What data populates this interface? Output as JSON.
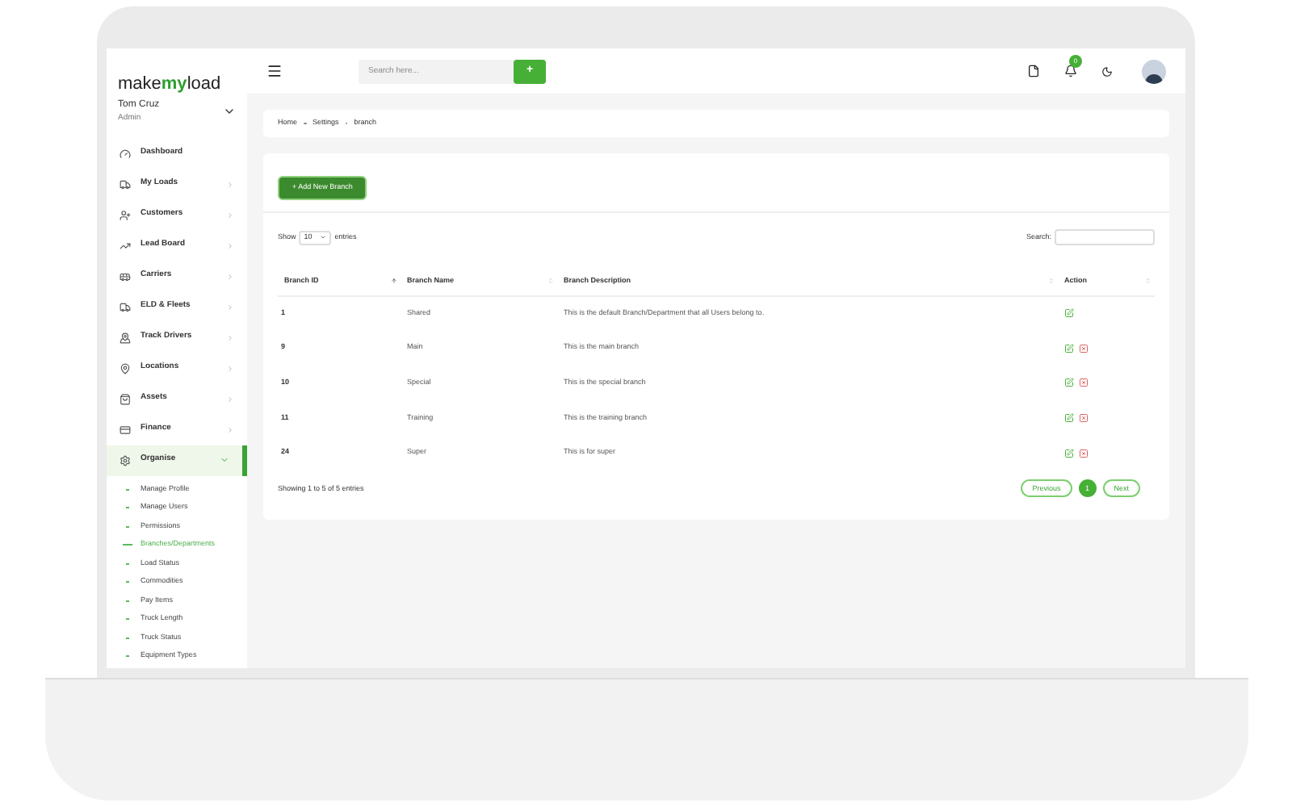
{
  "logo": {
    "part_1": "make",
    "part_2": "my",
    "part_3": "load"
  },
  "user": {
    "name": "Tom Cruz",
    "role": "Admin"
  },
  "sidebar": {
    "items": [
      {
        "label": "Dashboard",
        "has_submenu": false,
        "expanded": false,
        "selected": false
      },
      {
        "label": "My Loads",
        "has_submenu": true,
        "expanded": false,
        "selected": false
      },
      {
        "label": "Customers",
        "has_submenu": true,
        "expanded": false,
        "selected": false
      },
      {
        "label": "Lead Board",
        "has_submenu": true,
        "expanded": false,
        "selected": false
      },
      {
        "label": "Carriers",
        "has_submenu": true,
        "expanded": false,
        "selected": false
      },
      {
        "label": "ELD & Fleets",
        "has_submenu": true,
        "expanded": false,
        "selected": false
      },
      {
        "label": "Track Drivers",
        "has_submenu": true,
        "expanded": false,
        "selected": false
      },
      {
        "label": "Locations",
        "has_submenu": true,
        "expanded": false,
        "selected": false
      },
      {
        "label": "Assets",
        "has_submenu": true,
        "expanded": false,
        "selected": false
      },
      {
        "label": "Finance",
        "has_submenu": true,
        "expanded": false,
        "selected": false
      },
      {
        "label": "Organise",
        "has_submenu": true,
        "expanded": true,
        "selected": true,
        "children": [
          {
            "label": "Manage Profile",
            "selected": false
          },
          {
            "label": "Manage Users",
            "selected": false
          },
          {
            "label": "Permissions",
            "selected": false
          },
          {
            "label": "Branches/Departments",
            "selected": true
          },
          {
            "label": "Load Status",
            "selected": false
          },
          {
            "label": "Commodities",
            "selected": false
          },
          {
            "label": "Pay Items",
            "selected": false
          },
          {
            "label": "Truck Length",
            "selected": false
          },
          {
            "label": "Truck Status",
            "selected": false
          },
          {
            "label": "Equipment Types",
            "selected": false
          }
        ]
      }
    ]
  },
  "header": {
    "search": {
      "placeholder": "Search here..."
    },
    "search_button": "+",
    "notification_count": "0"
  },
  "breadcrumb": [
    "Home",
    "Settings",
    "branch"
  ],
  "add_button": "+ Add New Branch",
  "table_controls": {
    "show_label": "Show",
    "page_size": "10",
    "entries_label": "entries",
    "search_label": "Search:"
  },
  "table": {
    "columns": [
      "Branch ID",
      "Branch Name",
      "Branch Description",
      "Action"
    ],
    "rows": [
      {
        "id": "1",
        "name": "Shared",
        "description": "This is the default Branch/Department that all Users belong to.",
        "deletable": false
      },
      {
        "id": "9",
        "name": "Main",
        "description": "This is the main branch",
        "deletable": true
      },
      {
        "id": "10",
        "name": "Special",
        "description": "This is the special branch",
        "deletable": true
      },
      {
        "id": "11",
        "name": "Training",
        "description": "This is the training branch",
        "deletable": true
      },
      {
        "id": "24",
        "name": "Super",
        "description": "This is for super",
        "deletable": true
      }
    ]
  },
  "footer": {
    "summary": "Showing 1 to 5 of 5 entries",
    "previous": "Previous",
    "pages": [
      {
        "label": "1",
        "selected": true
      }
    ],
    "next": "Next"
  }
}
